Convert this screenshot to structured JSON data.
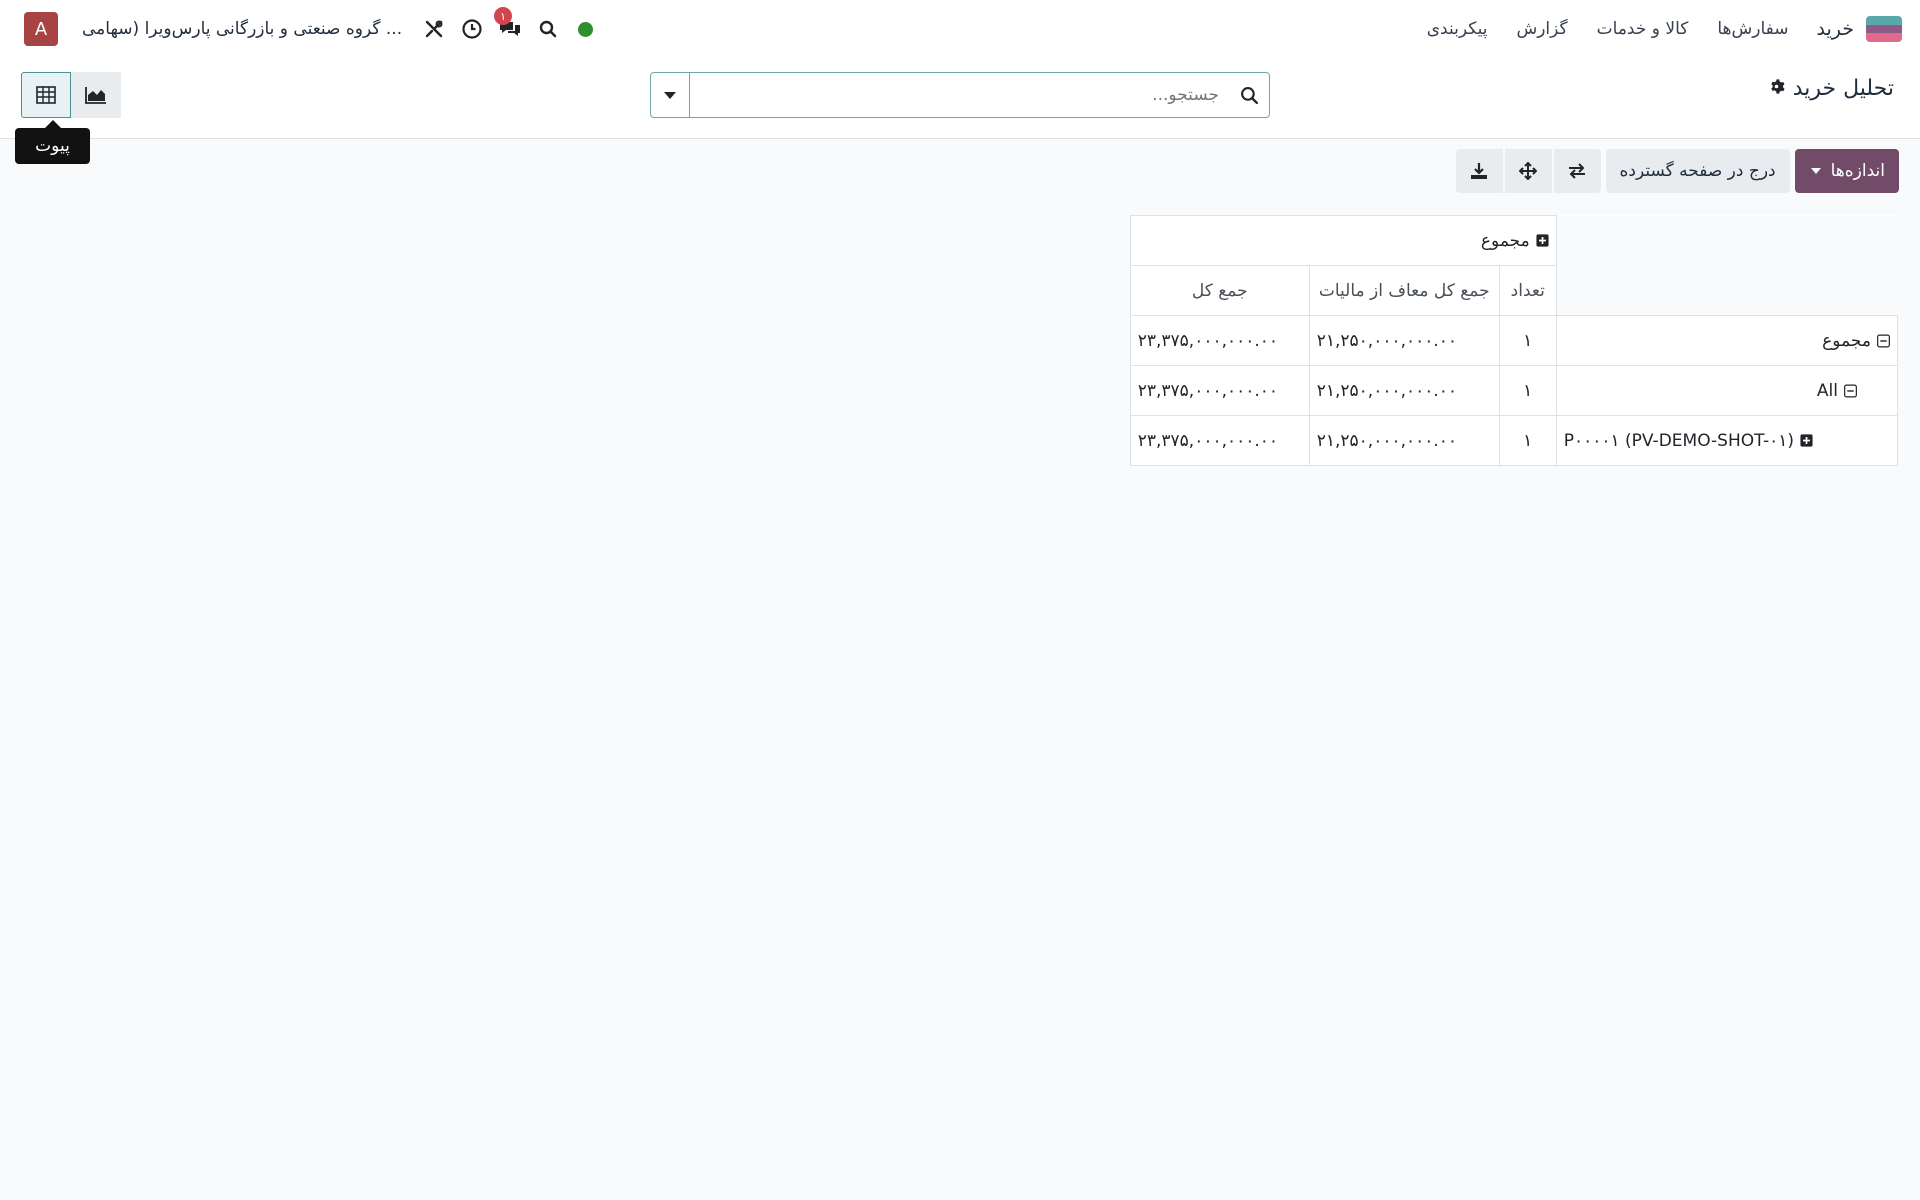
{
  "navbar": {
    "app_name": "خرید",
    "menu": [
      "سفارش‌ها",
      "کالا و خدمات",
      "گزارش",
      "پیکربندی"
    ],
    "company": "گروه صنعتی و بازرگانی پارس‌ویرا (سهامی ...",
    "avatar_letter": "A",
    "messages_badge": "۱",
    "status_color": "#2f8f2f"
  },
  "control": {
    "title": "تحلیل خرید",
    "search_placeholder": "جستجو..."
  },
  "views": {
    "tooltip": "پیوت"
  },
  "toolbar": {
    "measures_label": "اندازه‌ها",
    "insert_label": "درج در صفحه گسترده"
  },
  "pivot": {
    "col_header_total": "مجموع",
    "measures": [
      "تعداد",
      "جمع کل معاف از مالیات",
      "جمع کل"
    ],
    "rows": [
      {
        "label": "مجموع",
        "count": "۱",
        "untaxed": "۲۱,۲۵۰,۰۰۰,۰۰۰.۰۰",
        "total": "۲۳,۳۷۵,۰۰۰,۰۰۰.۰۰"
      },
      {
        "label": "All",
        "count": "۱",
        "untaxed": "۲۱,۲۵۰,۰۰۰,۰۰۰.۰۰",
        "total": "۲۳,۳۷۵,۰۰۰,۰۰۰.۰۰"
      },
      {
        "label": "P۰۰۰۰۱ (PV-DEMO-SHOT-۰۱)",
        "count": "۱",
        "untaxed": "۲۱,۲۵۰,۰۰۰,۰۰۰.۰۰",
        "total": "۲۳,۳۷۵,۰۰۰,۰۰۰.۰۰"
      }
    ]
  },
  "colors": {
    "brand": "#714b67",
    "accent": "#71a4a9"
  }
}
